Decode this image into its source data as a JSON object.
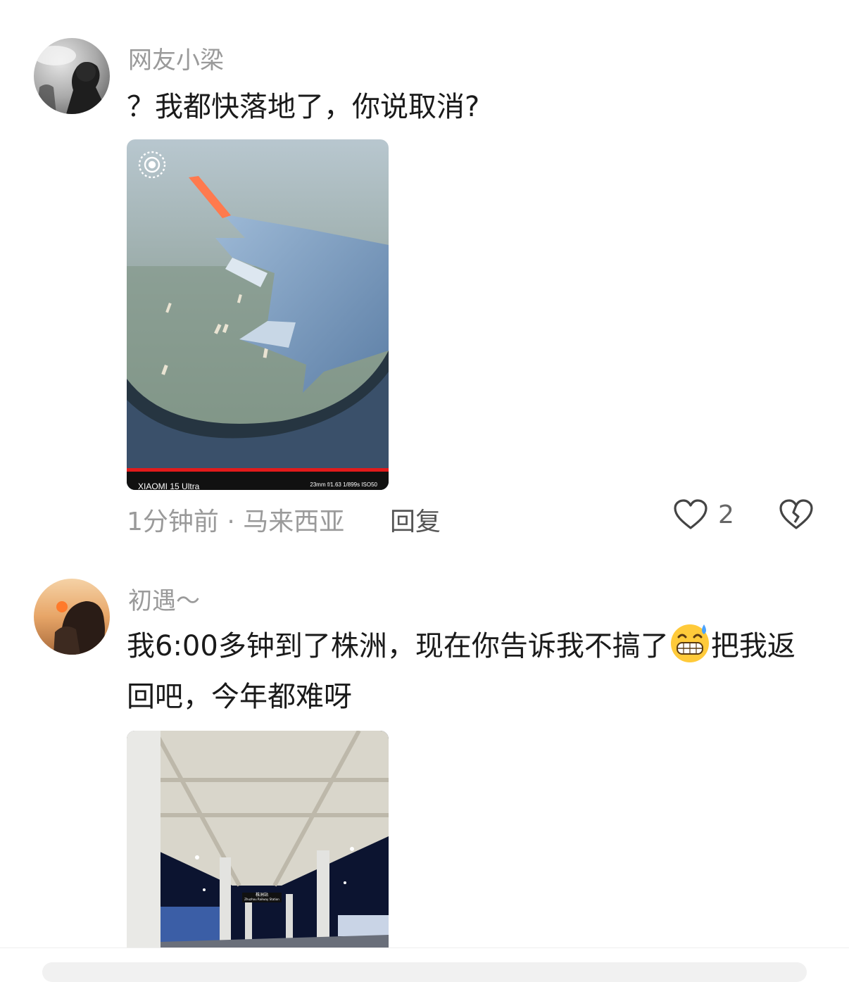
{
  "comments": [
    {
      "username": "网友小梁",
      "text": "？我都快落地了，你说取消?",
      "avatar_icon": "person-portrait-avatar",
      "image": {
        "subject": "airplane-wing-window",
        "camera_text": "XIAOMI 15 Ultra",
        "exif_text": "23mm  f/1.63  1/899s  ISO50"
      },
      "meta": "1分钟前 · 马来西亚",
      "reply_label": "回复",
      "like_count": "2"
    },
    {
      "username": "初遇～",
      "text_before_emoji": "我6:00多钟到了株洲，现在你告诉我不搞了",
      "emoji_icon": "grinning-sweat-emoji",
      "text_after_emoji": "把我返回吧，今年都难呀",
      "avatar_icon": "sunset-girl-avatar",
      "image": {
        "subject": "railway-station-platform",
        "station_sign": "株洲站",
        "station_sign_en": "Zhuzhou Railway Station"
      }
    }
  ],
  "colors": {
    "username": "#9a9a9a",
    "body_text": "#1a1a1a",
    "meta": "#9a9a9a"
  }
}
